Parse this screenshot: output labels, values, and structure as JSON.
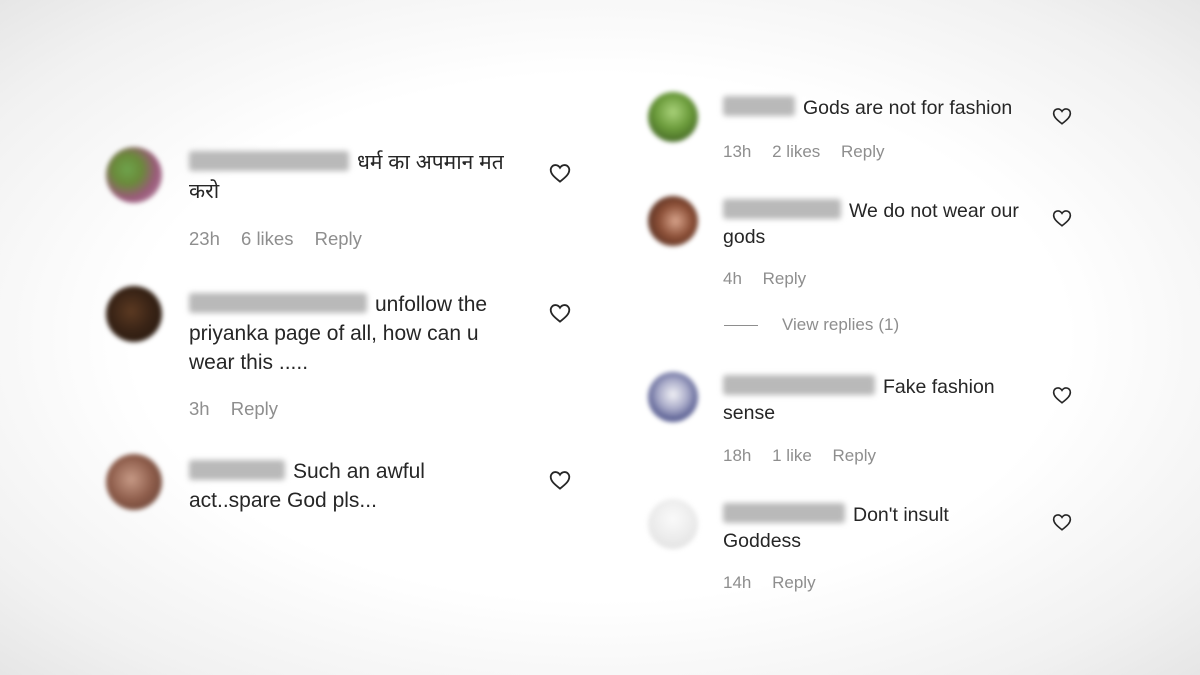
{
  "left_comments": [
    {
      "text": "धर्म का अपमान मत करो",
      "time": "23h",
      "likes": "6 likes",
      "reply": "Reply"
    },
    {
      "text": "unfollow the priyanka page of all, how can u wear this .....",
      "time": "3h",
      "likes": "",
      "reply": "Reply"
    },
    {
      "text": "Such an awful act..spare God pls...",
      "time": "",
      "likes": "",
      "reply": ""
    }
  ],
  "right_comments": [
    {
      "text": "Gods are not for fashion",
      "time": "13h",
      "likes": "2 likes",
      "reply": "Reply"
    },
    {
      "text": "We do not wear our gods",
      "time": "4h",
      "likes": "",
      "reply": "Reply"
    },
    {
      "text": "Fake fashion sense",
      "time": "18h",
      "likes": "1 like",
      "reply": "Reply"
    },
    {
      "text": "Don't insult Goddess",
      "time": "14h",
      "likes": "",
      "reply": "Reply"
    }
  ],
  "view_replies": {
    "label": "View replies",
    "count": "(1)"
  },
  "icons": {
    "like": "heart-outline-icon"
  },
  "colors": {
    "text": "#262626",
    "meta": "#8e8e8e",
    "background": "#ffffff"
  }
}
